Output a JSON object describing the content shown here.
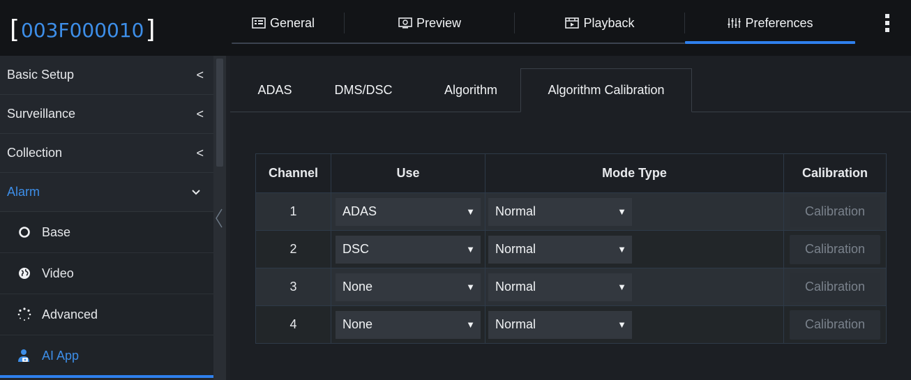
{
  "header": {
    "device_id": "003F000010",
    "tabs": [
      {
        "label": "General",
        "icon": "general-icon"
      },
      {
        "label": "Preview",
        "icon": "preview-icon"
      },
      {
        "label": "Playback",
        "icon": "playback-icon"
      },
      {
        "label": "Preferences",
        "icon": "preferences-icon"
      }
    ],
    "active_tab": "Preferences",
    "accent_color": "#2f80ed"
  },
  "sidebar": {
    "items": [
      {
        "label": "Basic Setup",
        "chevron": "<"
      },
      {
        "label": "Surveillance",
        "chevron": "<"
      },
      {
        "label": "Collection",
        "chevron": "<"
      },
      {
        "label": "Alarm",
        "chevron": "⌄"
      }
    ],
    "sub_items": [
      {
        "label": "Base",
        "icon": "circle-icon"
      },
      {
        "label": "Video",
        "icon": "globe-icon"
      },
      {
        "label": "Advanced",
        "icon": "dots-ring-icon"
      },
      {
        "label": "AI App",
        "icon": "ai-user-icon"
      }
    ]
  },
  "content": {
    "subtabs": [
      "ADAS",
      "DMS/DSC",
      "Algorithm",
      "Algorithm Calibration"
    ],
    "active_subtab": "Algorithm Calibration",
    "table": {
      "headers": [
        "Channel",
        "Use",
        "Mode Type",
        "Calibration"
      ],
      "rows": [
        {
          "channel": "1",
          "use": "ADAS",
          "mode": "Normal",
          "calibration": "Calibration"
        },
        {
          "channel": "2",
          "use": "DSC",
          "mode": "Normal",
          "calibration": "Calibration"
        },
        {
          "channel": "3",
          "use": "None",
          "mode": "Normal",
          "calibration": "Calibration"
        },
        {
          "channel": "4",
          "use": "None",
          "mode": "Normal",
          "calibration": "Calibration"
        }
      ]
    }
  }
}
